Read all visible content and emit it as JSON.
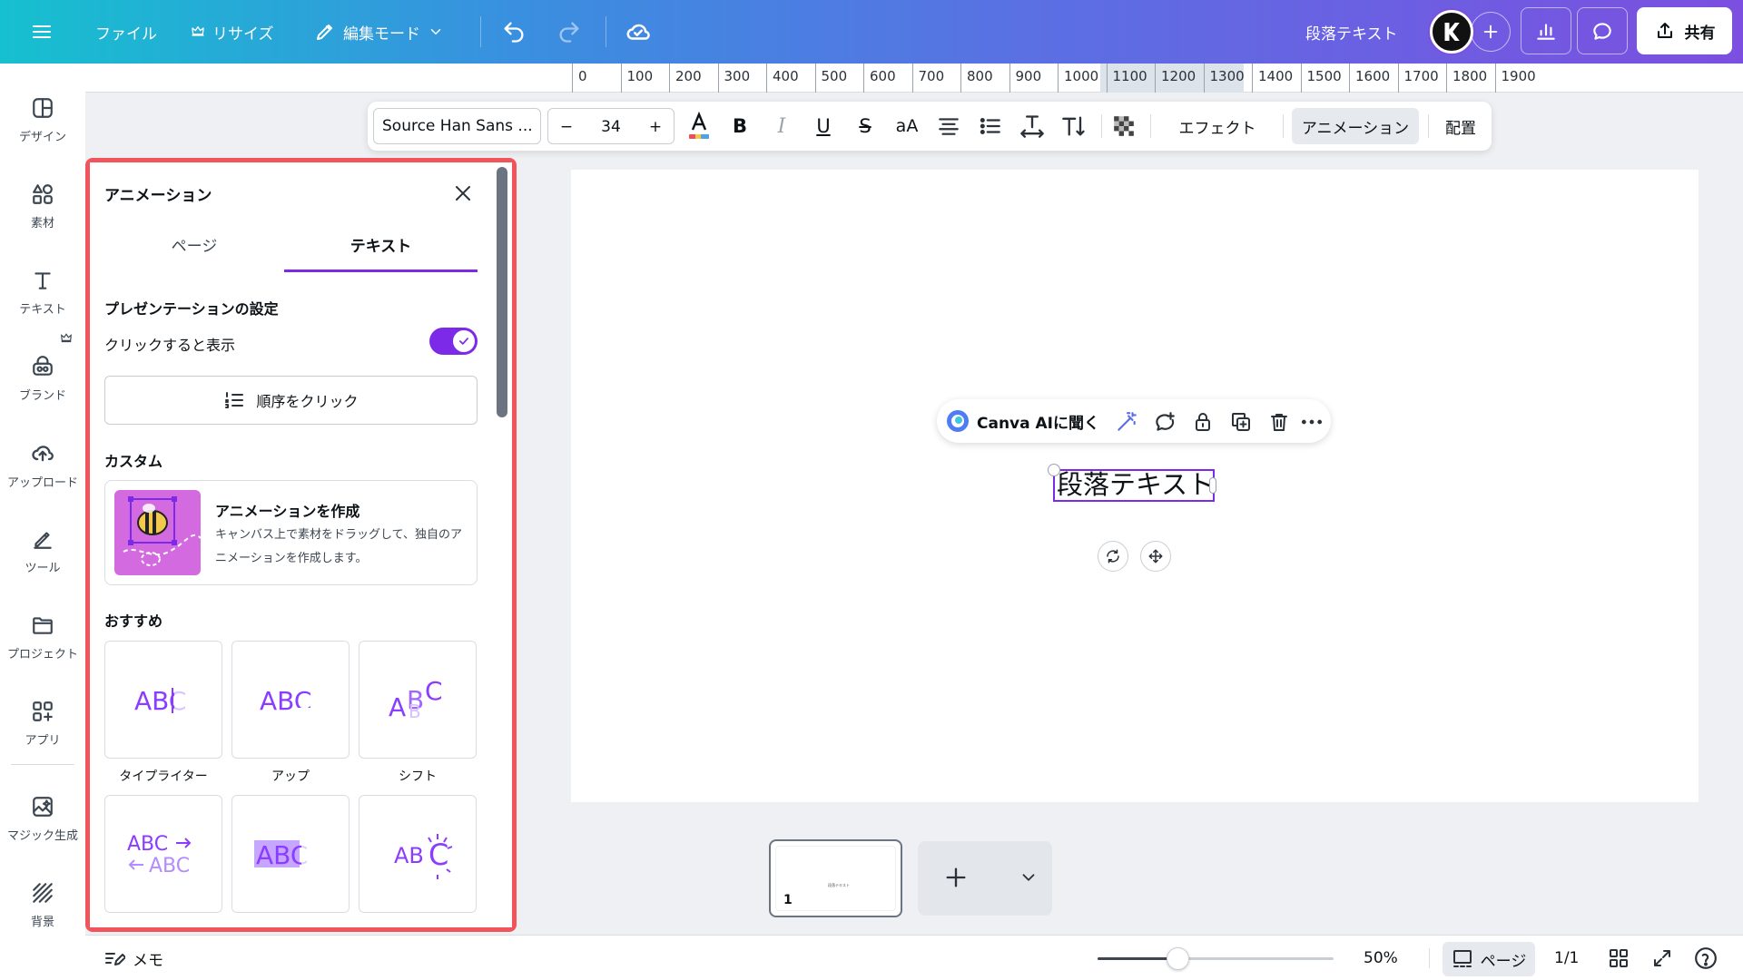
{
  "header": {
    "file_label": "ファイル",
    "resize_label": "リサイズ",
    "edit_mode_label": "編集モード",
    "doc_title": "段落テキスト",
    "share_label": "共有"
  },
  "rail": {
    "items": [
      {
        "label": "デザイン",
        "icon": "design-icon"
      },
      {
        "label": "素材",
        "icon": "elements-icon"
      },
      {
        "label": "テキスト",
        "icon": "text-icon"
      },
      {
        "label": "ブランド",
        "icon": "brand-icon"
      },
      {
        "label": "アップロード",
        "icon": "upload-icon"
      },
      {
        "label": "ツール",
        "icon": "tools-icon"
      },
      {
        "label": "プロジェクト",
        "icon": "folder-icon"
      },
      {
        "label": "アプリ",
        "icon": "apps-icon"
      },
      {
        "label": "マジック生成",
        "icon": "magic-icon"
      },
      {
        "label": "背景",
        "icon": "background-icon"
      }
    ]
  },
  "ruler": {
    "marks": [
      "0",
      "100",
      "200",
      "300",
      "400",
      "500",
      "600",
      "700",
      "800",
      "900",
      "1000",
      "1100",
      "1200",
      "1300",
      "1400",
      "1500",
      "1600",
      "1700",
      "1800",
      "1900"
    ]
  },
  "toolbar": {
    "font_name": "Source Han Sans ...",
    "font_size": "34",
    "minus": "−",
    "plus": "+",
    "bold": "B",
    "italic": "I",
    "underline": "U",
    "strike": "S",
    "case": "aA",
    "effects_label": "エフェクト",
    "animation_label": "アニメーション",
    "position_label": "配置"
  },
  "panel": {
    "title": "アニメーション",
    "tabs": [
      {
        "label": "ページ",
        "active": false
      },
      {
        "label": "テキスト",
        "active": true
      }
    ],
    "presentation_heading": "プレゼンテーションの設定",
    "click_to_show_label": "クリックすると表示",
    "click_to_show_on": true,
    "order_button_label": "順序をクリック",
    "custom_heading": "カスタム",
    "custom_card": {
      "title": "アニメーションを作成",
      "description": "キャンバス上で素材をドラッグして、独自のアニメーションを作成します。"
    },
    "recommended_heading": "おすすめ",
    "presets": [
      {
        "label": "タイプライター",
        "preview": "ABC"
      },
      {
        "label": "アップ",
        "preview": "ABC"
      },
      {
        "label": "シフト",
        "preview": "ABC"
      },
      {
        "label": "",
        "preview": "ABC"
      },
      {
        "label": "",
        "preview": "ABC"
      },
      {
        "label": "",
        "preview": "ABC"
      }
    ]
  },
  "canvas": {
    "ai_button_label": "Canva AIに聞く",
    "selected_text": "段落テキスト"
  },
  "pages": {
    "current_page_number": "1",
    "thumb_text": "段落テキスト"
  },
  "bottom": {
    "memo_label": "メモ",
    "zoom_value": 50,
    "zoom_label": "50%",
    "page_view_label": "ページ",
    "page_count": "1/1"
  },
  "colors": {
    "accent": "#7d2ae8",
    "panel_highlight": "#f2545b"
  }
}
